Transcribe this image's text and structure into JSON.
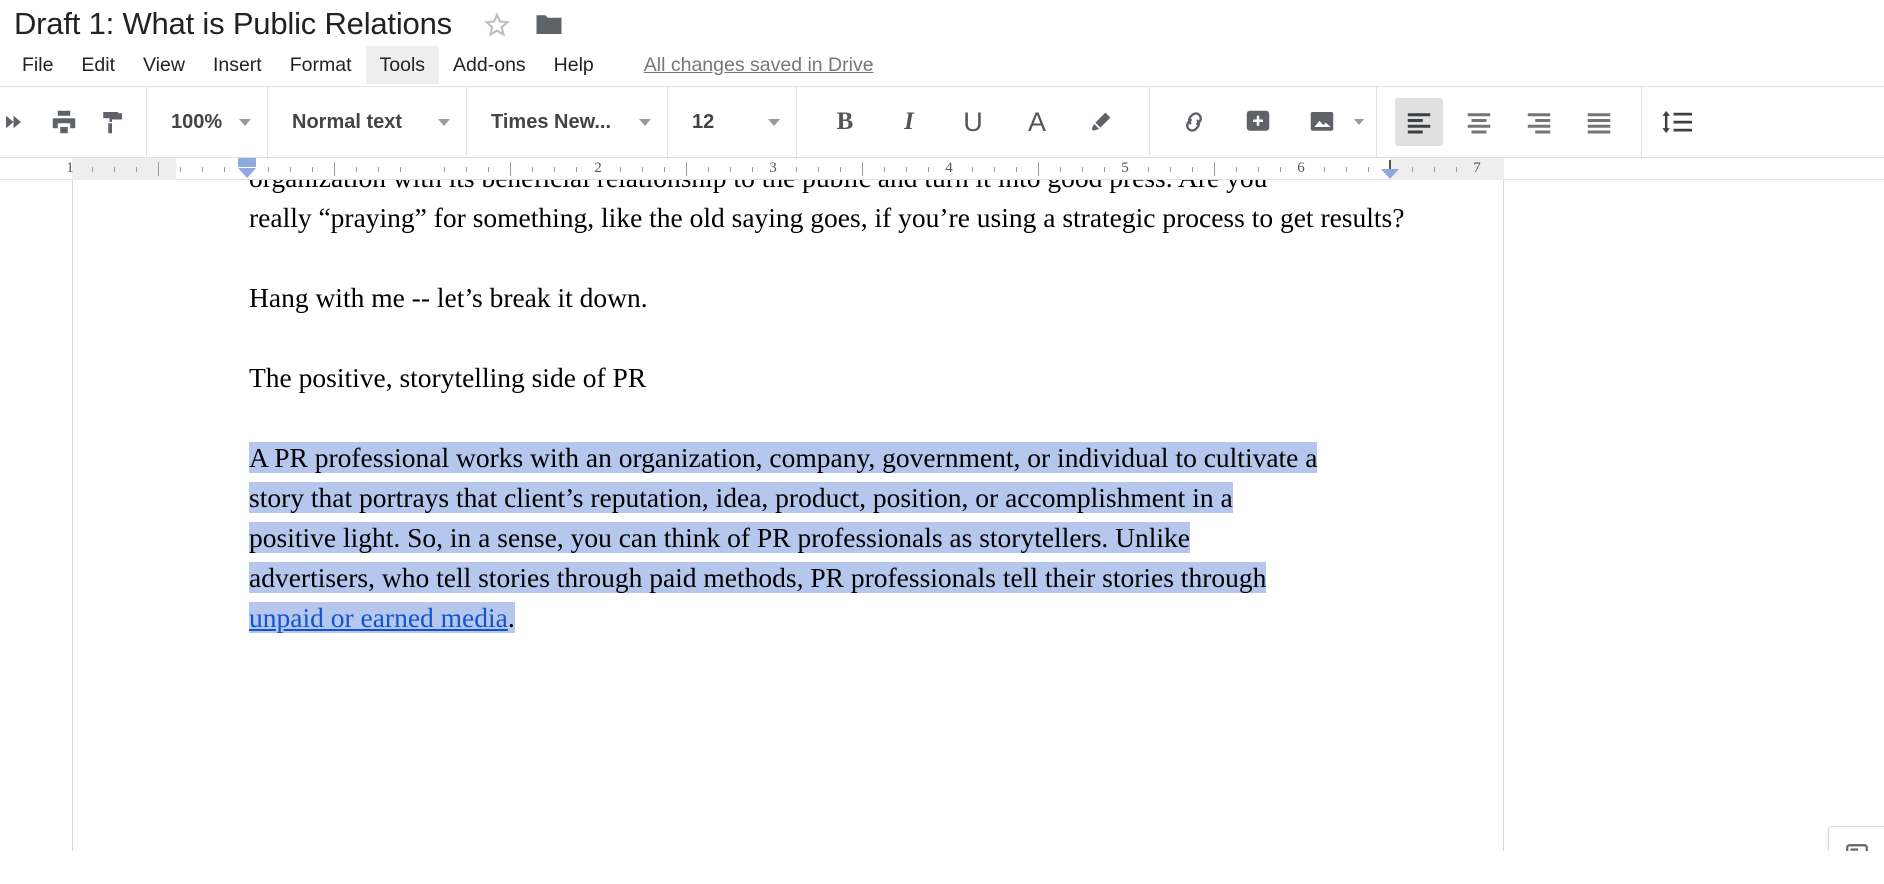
{
  "window": {
    "app": "Google Docs",
    "doc_title": "Draft 1: What is Public Relations"
  },
  "title_bar": {
    "star_icon": "star-outline-icon",
    "folder_icon": "folder-icon"
  },
  "menu": {
    "items": [
      {
        "label": "File",
        "active": false
      },
      {
        "label": "Edit",
        "active": false
      },
      {
        "label": "View",
        "active": false
      },
      {
        "label": "Insert",
        "active": false
      },
      {
        "label": "Format",
        "active": false
      },
      {
        "label": "Tools",
        "active": true
      },
      {
        "label": "Add-ons",
        "active": false
      },
      {
        "label": "Help",
        "active": false
      }
    ],
    "save_status": "All changes saved in Drive"
  },
  "toolbar": {
    "redo_icon": "redo-icon",
    "print_icon": "print-icon",
    "paint_format_icon": "paint-format-icon",
    "zoom_value": "100%",
    "style_value": "Normal text",
    "font_value": "Times New...",
    "font_size_value": "12",
    "bold_label": "B",
    "italic_label": "I",
    "underline_label": "U",
    "text_color_label": "A",
    "highlight_icon": "highlighter-icon",
    "link_icon": "link-icon",
    "comment_icon": "add-comment-icon",
    "image_icon": "insert-image-icon",
    "align_left_icon": "align-left-icon",
    "align_center_icon": "align-center-icon",
    "align_right_icon": "align-right-icon",
    "align_justify_icon": "align-justify-icon",
    "line_spacing_icon": "line-spacing-icon",
    "align_active": "left"
  },
  "ruler": {
    "numbers": [
      "1",
      "2",
      "3",
      "4",
      "5",
      "6",
      "7"
    ],
    "left_indent_marker": "left-indent-marker",
    "right_indent_marker": "right-indent-marker"
  },
  "document": {
    "line_clipped_top": "organization with its beneficial relationship to the public and turn it into good press. Are you",
    "para_1_rest": "really “praying” for something, like the old saying goes, if you’re using a strategic process to get results?",
    "para_2": "Hang with me -- let’s break it down.",
    "para_3": "The positive, storytelling side of PR",
    "para_4_selected_line1": "A PR professional works with an organization, company, government, or individual to cultivate a",
    "para_4_selected_line2": "story that portrays that client’s reputation, idea, product, position, or accomplishment in a",
    "para_4_selected_line3": "positive light. So, in a sense, you can think of PR professionals as storytellers. Unlike",
    "para_4_selected_line4": "advertisers, who tell stories through paid methods, PR professionals tell their stories through",
    "para_4_link_text": "unpaid or earned media",
    "para_4_period": ".",
    "line_clipped_bottom": " "
  },
  "colors": {
    "selection_highlight": "#b5c7ed",
    "link": "#1155cc",
    "menu_active_bg": "#eeeeee",
    "toolbar_icon": "#5f6368",
    "save_status_text": "#777777"
  },
  "side_panel": {
    "explore_icon": "explore-icon"
  }
}
